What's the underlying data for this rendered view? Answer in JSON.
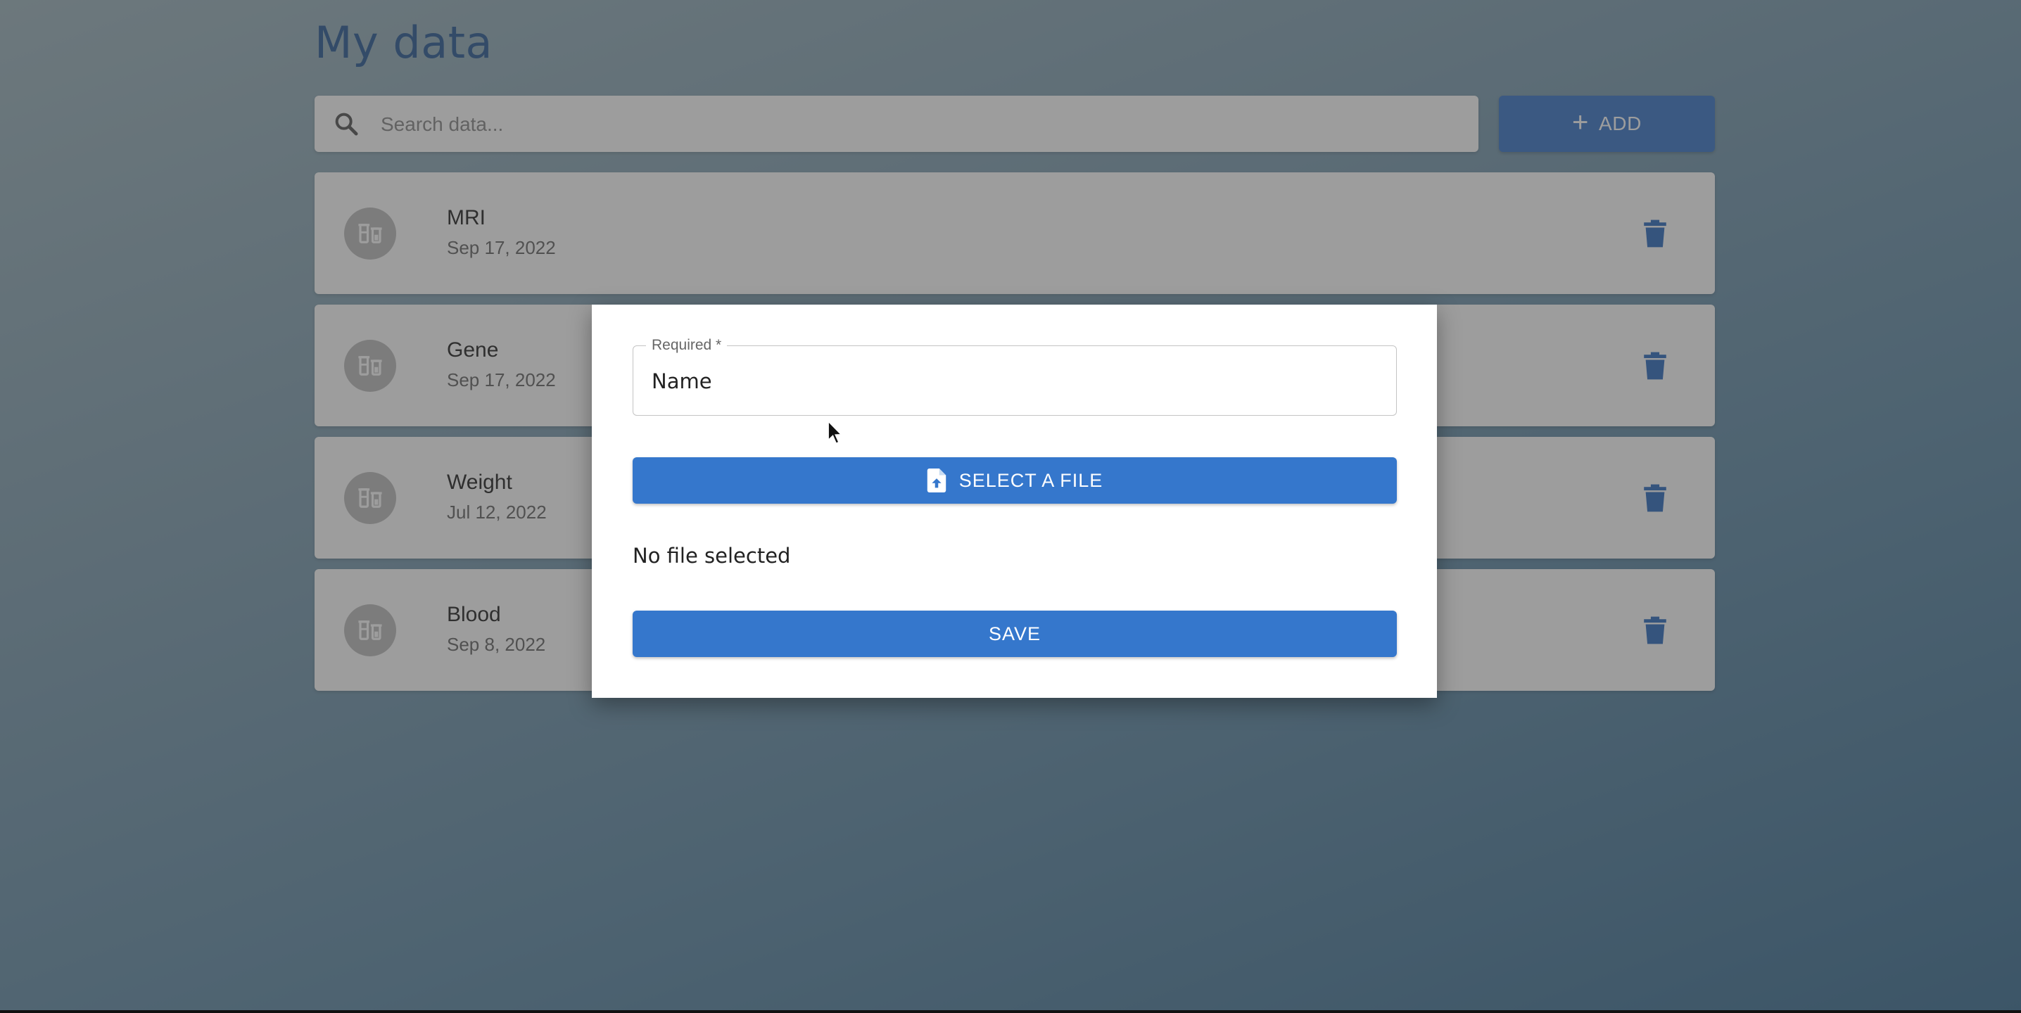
{
  "page": {
    "title": "My data"
  },
  "search": {
    "placeholder": "Search data..."
  },
  "toolbar": {
    "add_label": "ADD"
  },
  "items": [
    {
      "name": "MRI",
      "date": "Sep 17, 2022"
    },
    {
      "name": "Gene",
      "date": "Sep 17, 2022"
    },
    {
      "name": "Weight",
      "date": "Jul 12, 2022"
    },
    {
      "name": "Blood",
      "date": "Sep 8, 2022"
    }
  ],
  "dialog": {
    "name_field": {
      "label": "Required *",
      "placeholder": "Name",
      "value": ""
    },
    "select_file_label": "SELECT A FILE",
    "file_status": "No file selected",
    "save_label": "SAVE"
  },
  "icons": {
    "search": "search-icon",
    "add": "plus-icon",
    "avatar": "vials-icon",
    "delete": "trash-icon",
    "upload": "file-upload-icon",
    "cursor": "mouse-pointer-icon"
  },
  "colors": {
    "primary": "#3577cc",
    "title": "#2a5a95",
    "avatar_bg": "#bdbdbd"
  }
}
